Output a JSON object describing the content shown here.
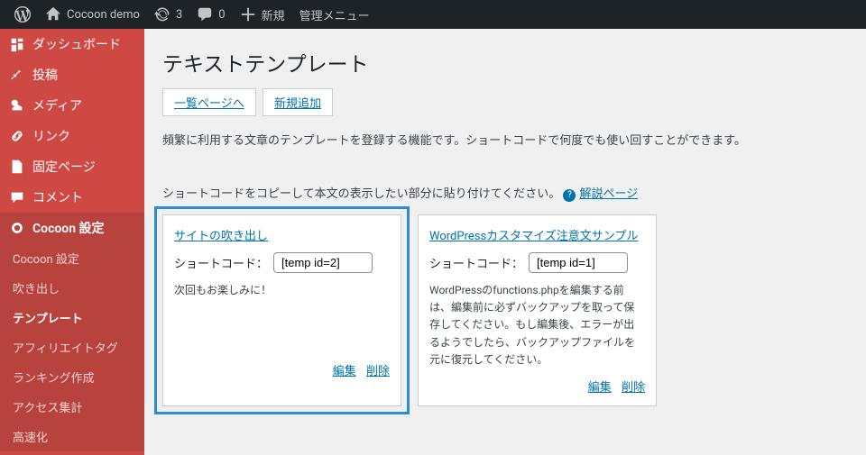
{
  "adminbar": {
    "site_name": "Cocoon demo",
    "updates": "3",
    "comments": "0",
    "new": "新規",
    "admin_menu": "管理メニュー"
  },
  "sidebar": {
    "items": [
      {
        "label": "ダッシュボード"
      },
      {
        "label": "投稿"
      },
      {
        "label": "メディア"
      },
      {
        "label": "リンク"
      },
      {
        "label": "固定ページ"
      },
      {
        "label": "コメント"
      },
      {
        "label": "Cocoon 設定"
      }
    ],
    "submenu": [
      {
        "label": "Cocoon 設定"
      },
      {
        "label": "吹き出し"
      },
      {
        "label": "テンプレート"
      },
      {
        "label": "アフィリエイトタグ"
      },
      {
        "label": "ランキング作成"
      },
      {
        "label": "アクセス集計"
      },
      {
        "label": "高速化"
      }
    ]
  },
  "page": {
    "title": "テキストテンプレート",
    "tab_list": "一覧ページへ",
    "tab_new": "新規追加",
    "description": "頻繁に利用する文章のテンプレートを登録する機能です。ショートコードで何度でも使い回すことができます。",
    "instruction": "ショートコードをコピーして本文の表示したい部分に貼り付けてください。",
    "help_link": "解説ページ",
    "shortcode_label": "ショートコード："
  },
  "cards": [
    {
      "title": "サイトの吹き出し",
      "shortcode": "[temp id=2]",
      "content": "次回もお楽しみに！",
      "edit": "編集",
      "delete": "削除"
    },
    {
      "title": "WordPressカスタマイズ注意文サンプル",
      "shortcode": "[temp id=1]",
      "content": "WordPressのfunctions.phpを編集する前は、編集前に必ずバックアップを取って保存してください。もし編集後、エラーが出るようでしたら、バックアップファイルを元に復元してください。",
      "edit": "編集",
      "delete": "削除"
    }
  ]
}
